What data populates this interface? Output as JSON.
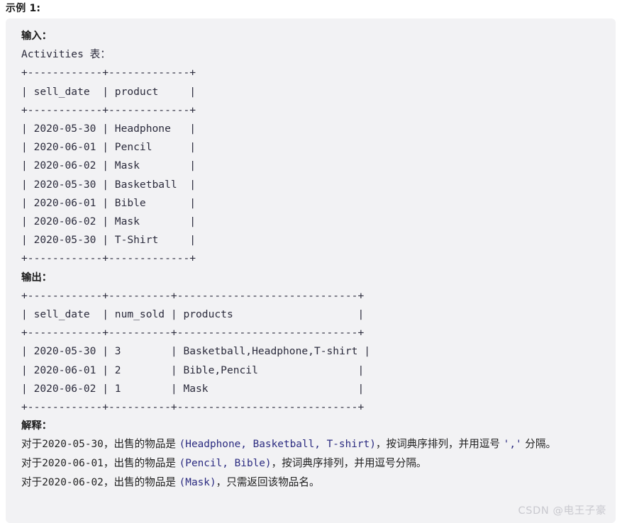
{
  "heading": {
    "text": "示例 1:"
  },
  "input_section": {
    "label": "输入：",
    "table_caption": "Activities 表：",
    "table_text": "+------------+-------------+\n| sell_date  | product     |\n+------------+-------------+\n| 2020-05-30 | Headphone   |\n| 2020-06-01 | Pencil      |\n| 2020-06-02 | Mask        |\n| 2020-05-30 | Basketball  |\n| 2020-06-01 | Bible       |\n| 2020-06-02 | Mask        |\n| 2020-05-30 | T-Shirt     |\n+------------+-------------+",
    "table": {
      "columns": [
        "sell_date",
        "product"
      ],
      "rows": [
        [
          "2020-05-30",
          "Headphone"
        ],
        [
          "2020-06-01",
          "Pencil"
        ],
        [
          "2020-06-02",
          "Mask"
        ],
        [
          "2020-05-30",
          "Basketball"
        ],
        [
          "2020-06-01",
          "Bible"
        ],
        [
          "2020-06-02",
          "Mask"
        ],
        [
          "2020-05-30",
          "T-Shirt"
        ]
      ]
    }
  },
  "output_section": {
    "label": "输出：",
    "table_text": "+------------+----------+-----------------------------+\n| sell_date  | num_sold | products                    |\n+------------+----------+-----------------------------+\n| 2020-05-30 | 3        | Basketball,Headphone,T-shirt |\n| 2020-06-01 | 2        | Bible,Pencil                |\n| 2020-06-02 | 1        | Mask                        |\n+------------+----------+-----------------------------+",
    "table": {
      "columns": [
        "sell_date",
        "num_sold",
        "products"
      ],
      "rows": [
        [
          "2020-05-30",
          "3",
          "Basketball,Headphone,T-shirt"
        ],
        [
          "2020-06-01",
          "2",
          "Bible,Pencil"
        ],
        [
          "2020-06-02",
          "1",
          "Mask"
        ]
      ]
    }
  },
  "explanation_section": {
    "label": "解释：",
    "line1_prefix": "对于",
    "line1_date": "2020-05-30",
    "line1_mid": "，出售的物品是 ",
    "line1_code": "(Headphone, Basketball, T-shirt)",
    "line1_suffix": "，按词典序排列，并用逗号 ",
    "line1_comma": "','",
    "line1_end": " 分隔。",
    "line2_prefix": "对于",
    "line2_date": "2020-06-01",
    "line2_mid": "，出售的物品是 ",
    "line2_code": "(Pencil, Bible)",
    "line2_suffix": "，按词典序排列，并用逗号分隔。",
    "line3_prefix": "对于",
    "line3_date": "2020-06-02",
    "line3_mid": "，出售的物品是 ",
    "line3_code": "(Mask)",
    "line3_suffix": "，只需返回该物品名。"
  },
  "watermark": {
    "text": "CSDN @电王子豪"
  },
  "colors": {
    "panel_background": "#f2f2f4",
    "page_background": "#ffffff",
    "code_text": "#2b2b3c",
    "code_accent": "#2b2b80",
    "body_text": "#1f1f1f",
    "watermark_text": "#c9c9cf"
  }
}
